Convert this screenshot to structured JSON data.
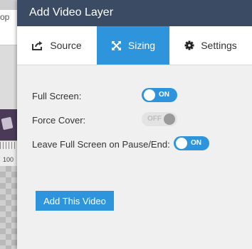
{
  "background_app": {
    "toolbar_fragment": "op",
    "ruler_label": "100"
  },
  "dialog": {
    "title": "Add Video Layer",
    "tabs": [
      {
        "label": "Source",
        "icon": "share-icon",
        "active": false
      },
      {
        "label": "Sizing",
        "icon": "resize-arrows-icon",
        "active": true
      },
      {
        "label": "Settings",
        "icon": "gear-icon",
        "active": false
      }
    ],
    "options": [
      {
        "label": "Full Screen:",
        "state": "ON",
        "enabled": true
      },
      {
        "label": "Force Cover:",
        "state": "OFF",
        "enabled": false
      },
      {
        "label": "Leave Full Screen on Pause/End:",
        "state": "ON",
        "enabled": true
      }
    ],
    "add_button_label": "Add This Video"
  },
  "colors": {
    "header_bg": "#3b4b63",
    "accent": "#2e95dc",
    "panel_bg": "#f0f0f0"
  }
}
